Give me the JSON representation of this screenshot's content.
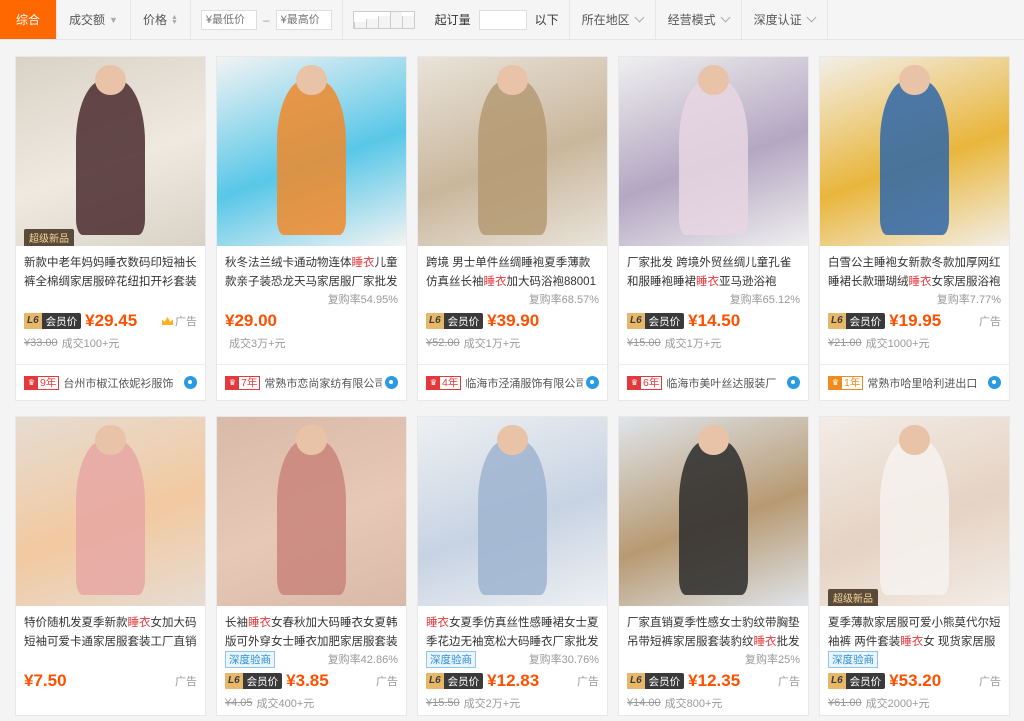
{
  "filters": {
    "tabs": [
      {
        "label": "综合",
        "active": true
      },
      {
        "label": "成交额"
      },
      {
        "label": "价格"
      }
    ],
    "price_min_placeholder": "¥最低价",
    "price_max_placeholder": "¥最高价",
    "dash": "–",
    "min_qty_label": "起订量",
    "min_qty_suffix": "以下",
    "region": "所在地区",
    "mode": "经营模式",
    "depth": "深度认证"
  },
  "colors": {
    "accent": "#ff6700",
    "price": "#ff5000",
    "keyword": "#e4393c"
  },
  "products": [
    {
      "title_pre": "新款中老年妈妈睡衣数码印短袖长裤全棉绸家居服碎花纽扣开衫套装",
      "kw": "",
      "title_post": "",
      "badge": "超级新品",
      "repurchase": "",
      "vip": true,
      "price": "¥29.45",
      "ad": "广告",
      "crown": true,
      "orig": "¥33.00",
      "sales": "成交100+元",
      "years": "9年",
      "shop": "台州市椒江依妮衫服饰",
      "thumb": "a",
      "verified": false
    },
    {
      "title_pre": "秋冬法兰绒卡通动物连体",
      "kw": "睡衣",
      "title_post": "儿童款亲子装恐龙天马家居服厂家批发",
      "badge": "",
      "repurchase": "复购率54.95%",
      "vip": false,
      "price": "¥29.00",
      "ad": "",
      "crown": false,
      "orig": "",
      "sales": "成交3万+元",
      "years": "7年",
      "shop": "常熟市恋尚家纺有限公司",
      "thumb": "b",
      "verified": false
    },
    {
      "title_pre": "跨境 男士单件丝绸睡袍夏季薄款仿真丝长袖",
      "kw": "睡衣",
      "title_post": "加大码浴袍88001",
      "badge": "",
      "repurchase": "复购率68.57%",
      "vip": true,
      "price": "¥39.90",
      "ad": "",
      "crown": false,
      "orig": "¥52.00",
      "sales": "成交1万+元",
      "years": "4年",
      "shop": "临海市泾涌服饰有限公司",
      "thumb": "c",
      "verified": false
    },
    {
      "title_pre": "厂家批发 跨境外贸丝绸儿童孔雀和服睡袍睡裙",
      "kw": "睡衣",
      "title_post": "亚马逊浴袍",
      "badge": "",
      "repurchase": "复购率65.12%",
      "vip": true,
      "price": "¥14.50",
      "ad": "",
      "crown": false,
      "orig": "¥15.00",
      "sales": "成交1万+元",
      "years": "6年",
      "shop": "临海市美叶丝达服装厂",
      "thumb": "d",
      "verified": false
    },
    {
      "title_pre": "白雪公主睡袍女新款冬款加厚网红睡裙长款珊瑚绒",
      "kw": "睡衣",
      "title_post": "女家居服浴袍",
      "badge": "",
      "repurchase": "复购率7.77%",
      "vip": true,
      "price": "¥19.95",
      "ad": "广告",
      "crown": false,
      "orig": "¥21.00",
      "sales": "成交1000+元",
      "years": "1年",
      "shop": "常熟市哈里哈利进出口",
      "thumb": "e",
      "verified": false,
      "orange": true
    },
    {
      "title_pre": "特价随机发夏季新款",
      "kw": "睡衣",
      "title_post": "女加大码短袖可爱卡通家居服套装工厂直销",
      "badge": "",
      "repurchase": "",
      "vip": false,
      "price": "¥7.50",
      "ad": "广告",
      "crown": false,
      "orig": "",
      "sales": "",
      "years": "",
      "shop": "",
      "thumb": "f",
      "verified": false
    },
    {
      "title_pre": "长袖",
      "kw": "睡衣",
      "title_post": "女春秋加大码睡衣女夏韩版可外穿女士睡衣加肥家居服套装",
      "badge": "",
      "repurchase": "复购率42.86%",
      "vip": true,
      "price": "¥3.85",
      "ad": "广告",
      "crown": false,
      "orig": "¥4.05",
      "sales": "成交400+元",
      "years": "",
      "shop": "",
      "thumb": "g",
      "verified": true
    },
    {
      "title_pre": "",
      "kw": "睡衣",
      "title_post": "女夏季仿真丝性感睡裙女士夏季花边无袖宽松大码睡衣厂家批发",
      "badge": "",
      "repurchase": "复购率30.76%",
      "vip": true,
      "price": "¥12.83",
      "ad": "广告",
      "crown": false,
      "orig": "¥15.50",
      "sales": "成交2万+元",
      "years": "",
      "shop": "",
      "thumb": "h",
      "verified": true
    },
    {
      "title_pre": "厂家直销夏季性感女士豹纹带胸垫吊带短裤家居服套装豹纹",
      "kw": "睡衣",
      "title_post": "批发",
      "badge": "",
      "repurchase": "复购率25%",
      "vip": true,
      "price": "¥12.35",
      "ad": "广告",
      "crown": false,
      "orig": "¥14.00",
      "sales": "成交800+元",
      "years": "",
      "shop": "",
      "thumb": "i",
      "verified": false
    },
    {
      "title_pre": "夏季薄款家居服可爱小熊莫代尔短袖裤 两件套装",
      "kw": "睡衣",
      "title_post": "女 现货家居服",
      "badge": "超级新品",
      "repurchase": "",
      "vip": true,
      "price": "¥53.20",
      "ad": "广告",
      "crown": false,
      "orig": "¥61.00",
      "sales": "成交2000+元",
      "years": "",
      "shop": "",
      "thumb": "j",
      "verified": true
    }
  ],
  "labels": {
    "vip_l6": "L6",
    "vip": "会员价",
    "verified": "深度验商"
  }
}
